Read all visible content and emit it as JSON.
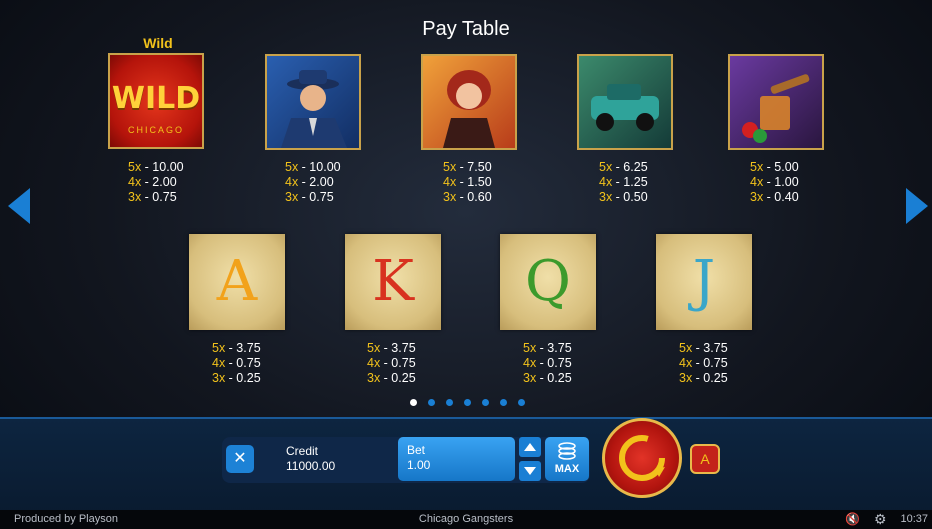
{
  "title": "Pay Table",
  "wild_label": "Wild",
  "wild_symbol_text": "WILD",
  "wild_symbol_subtext": "CHICAGO",
  "high_symbols": [
    {
      "name": "wild",
      "pays": [
        {
          "m": "5x",
          "v": " - 10.00"
        },
        {
          "m": "4x",
          "v": " - 2.00"
        },
        {
          "m": "3x",
          "v": " - 0.75"
        }
      ]
    },
    {
      "name": "gangster",
      "pays": [
        {
          "m": "5x",
          "v": " - 10.00"
        },
        {
          "m": "4x",
          "v": " - 2.00"
        },
        {
          "m": "3x",
          "v": " - 0.75"
        }
      ]
    },
    {
      "name": "lady",
      "pays": [
        {
          "m": "5x",
          "v": " - 7.50"
        },
        {
          "m": "4x",
          "v": " - 1.50"
        },
        {
          "m": "3x",
          "v": " - 0.60"
        }
      ]
    },
    {
      "name": "car",
      "pays": [
        {
          "m": "5x",
          "v": " - 6.25"
        },
        {
          "m": "4x",
          "v": " - 1.25"
        },
        {
          "m": "3x",
          "v": " - 0.50"
        }
      ]
    },
    {
      "name": "whiskey-cigar",
      "pays": [
        {
          "m": "5x",
          "v": " - 5.00"
        },
        {
          "m": "4x",
          "v": " - 1.00"
        },
        {
          "m": "3x",
          "v": " - 0.40"
        }
      ]
    }
  ],
  "low_symbols": [
    {
      "letter": "A",
      "color": "#f2a21b",
      "pays": [
        {
          "m": "5x",
          "v": " - 3.75"
        },
        {
          "m": "4x",
          "v": " - 0.75"
        },
        {
          "m": "3x",
          "v": " - 0.25"
        }
      ]
    },
    {
      "letter": "K",
      "color": "#d8321f",
      "pays": [
        {
          "m": "5x",
          "v": " - 3.75"
        },
        {
          "m": "4x",
          "v": " - 0.75"
        },
        {
          "m": "3x",
          "v": " - 0.25"
        }
      ]
    },
    {
      "letter": "Q",
      "color": "#3c9a2c",
      "pays": [
        {
          "m": "5x",
          "v": " - 3.75"
        },
        {
          "m": "4x",
          "v": " - 0.75"
        },
        {
          "m": "3x",
          "v": " - 0.25"
        }
      ]
    },
    {
      "letter": "J",
      "color": "#3aa6c9",
      "pays": [
        {
          "m": "5x",
          "v": " - 3.75"
        },
        {
          "m": "4x",
          "v": " - 0.75"
        },
        {
          "m": "3x",
          "v": " - 0.25"
        }
      ]
    }
  ],
  "pagination": {
    "pages": 7,
    "current": 1
  },
  "controls": {
    "close": "✕",
    "credit_label": "Credit",
    "credit_value": "11000.00",
    "bet_label": "Bet",
    "bet_value": "1.00",
    "max_label": "MAX",
    "autoplay_icon": "A"
  },
  "footer": {
    "produced_by": "Produced by Playson",
    "game_name": "Chicago Gangsters",
    "time": "10:37"
  },
  "colors": {
    "accent": "#1a7fd4",
    "gold": "#f2c21b",
    "spin_red": "#c3221a"
  }
}
